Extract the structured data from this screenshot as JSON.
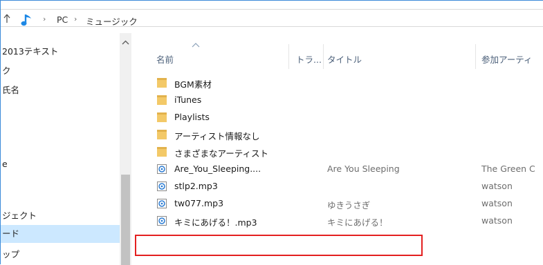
{
  "addressbar": {
    "crumbs": [
      "PC",
      "ミュージック"
    ],
    "separator": "›"
  },
  "nav": {
    "items": [
      {
        "label": "2013テキスト",
        "selected": false
      },
      {
        "label": "ク",
        "selected": false
      },
      {
        "label": "氏名",
        "selected": false
      },
      {
        "label": "",
        "selected": false
      },
      {
        "label": "",
        "selected": false
      },
      {
        "label": "e",
        "selected": false
      },
      {
        "label": "",
        "selected": false
      },
      {
        "label": "",
        "selected": false
      },
      {
        "label": "ジェクト",
        "selected": false
      },
      {
        "label": "ード",
        "selected": true
      },
      {
        "label": "ップ",
        "selected": false
      }
    ]
  },
  "columns": {
    "name": "名前",
    "track": "トラ...",
    "title": "タイトル",
    "artist": "参加アーティ"
  },
  "files": [
    {
      "name": "BGM素材",
      "type": "folder",
      "title": "",
      "artist": ""
    },
    {
      "name": "iTunes",
      "type": "folder",
      "title": "",
      "artist": ""
    },
    {
      "name": "Playlists",
      "type": "folder",
      "title": "",
      "artist": ""
    },
    {
      "name": "アーティスト情報なし",
      "type": "folder",
      "title": "",
      "artist": ""
    },
    {
      "name": "さまざまなアーティスト",
      "type": "folder",
      "title": "",
      "artist": ""
    },
    {
      "name": "Are_You_Sleeping....",
      "type": "audio",
      "title": "Are You Sleeping",
      "artist": "The Green C"
    },
    {
      "name": "stlp2.mp3",
      "type": "audio",
      "title": "",
      "artist": "watson"
    },
    {
      "name": "tw077.mp3",
      "type": "audio",
      "title": "ゆきうさぎ",
      "artist": "watson"
    },
    {
      "name": "キミにあげる！.mp3",
      "type": "audio",
      "title": "キミにあげる！",
      "artist": "watson"
    }
  ],
  "colors": {
    "folder": "#f3c968",
    "audio_icon": "#2b7cd3",
    "highlight": "#e31f1f",
    "selected": "#cce8ff"
  }
}
